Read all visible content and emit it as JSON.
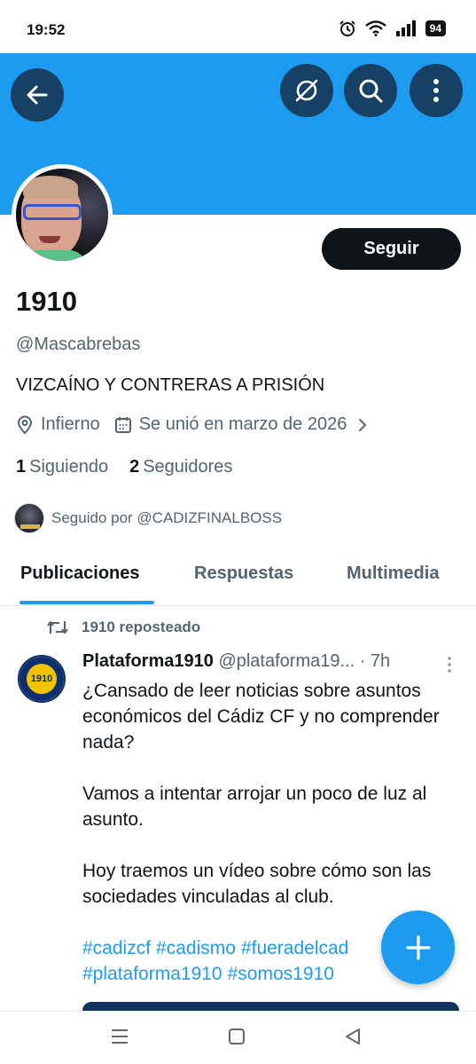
{
  "status_bar": {
    "time": "19:52",
    "battery": "94"
  },
  "profile": {
    "name": "1910",
    "handle": "@Mascabrebas",
    "bio": "VIZCAÍNO Y CONTRERAS A PRISIÓN",
    "location": "Infierno",
    "joined": "Se unió en marzo de 2026",
    "following_count": "1",
    "following_label": "Siguiendo",
    "followers_count": "2",
    "followers_label": "Seguidores",
    "followed_by": "Seguido por @CADIZFINALBOSS",
    "follow_button": "Seguir"
  },
  "tabs": [
    {
      "label": "Publicaciones",
      "active": true
    },
    {
      "label": "Respuestas",
      "active": false
    },
    {
      "label": "Multimedia",
      "active": false
    }
  ],
  "post": {
    "repost_label": "1910 reposteado",
    "author": "Plataforma1910",
    "handle": "@plataforma19...",
    "time": "· 7h",
    "avatar_text": "1910",
    "paragraphs": [
      "¿Cansado de leer noticias sobre asuntos económicos del Cádiz CF y no comprender nada?",
      "Vamos a intentar arrojar un poco de luz al asunto.",
      "Hoy traemos un vídeo sobre cómo son las sociedades vinculadas al club."
    ],
    "hashtags": [
      "#cadizcf",
      "#cadismo",
      "#fueradelcad",
      "#plataforma1910",
      "#somos1910"
    ]
  },
  "colors": {
    "accent": "#1d9bf0",
    "text": "#0f1419",
    "secondary": "#536471",
    "banner": "#1d9bf0"
  },
  "icons": [
    "back-arrow-icon",
    "grok-icon",
    "search-icon",
    "more-vertical-icon",
    "location-icon",
    "calendar-icon",
    "chevron-right-icon",
    "repost-icon",
    "plus-icon",
    "menu-icon",
    "home-icon",
    "back-triangle-icon"
  ]
}
